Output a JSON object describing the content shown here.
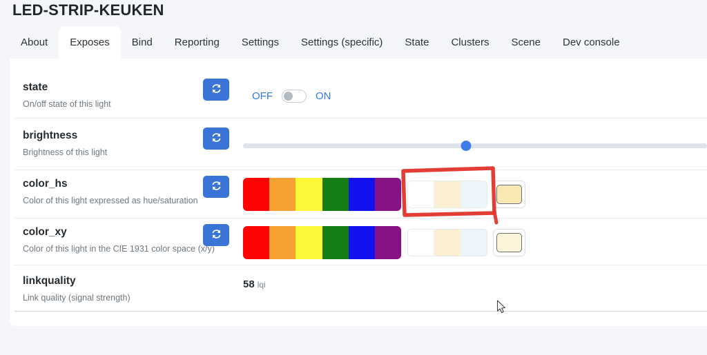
{
  "page": {
    "title": "LED-STRIP-KEUKEN"
  },
  "tabs": {
    "items": [
      {
        "label": "About",
        "active": false
      },
      {
        "label": "Exposes",
        "active": true
      },
      {
        "label": "Bind",
        "active": false
      },
      {
        "label": "Reporting",
        "active": false
      },
      {
        "label": "Settings",
        "active": false
      },
      {
        "label": "Settings (specific)",
        "active": false
      },
      {
        "label": "State",
        "active": false
      },
      {
        "label": "Clusters",
        "active": false
      },
      {
        "label": "Scene",
        "active": false
      },
      {
        "label": "Dev console",
        "active": false
      }
    ]
  },
  "exposes": {
    "rows": [
      {
        "name": "state",
        "description": "On/off state of this light",
        "toggle": {
          "off_label": "OFF",
          "on_label": "ON",
          "state": "off"
        }
      },
      {
        "name": "brightness",
        "description": "Brightness of this light",
        "slider": {
          "percent": 48
        }
      },
      {
        "name": "color_hs",
        "description": "Color of this light expressed as hue/saturation",
        "color_presets": [
          "#ff0202",
          "#f8a133",
          "#fdf73a",
          "#147d14",
          "#1311ee",
          "#861386"
        ],
        "white_presets": [
          "#ffffff",
          "#fcf0d2",
          "#edf7fb"
        ],
        "picker_color": "#f8e8b4",
        "annotated": true
      },
      {
        "name": "color_xy",
        "description": "Color of this light in the CIE 1931 color space (x/y)",
        "color_presets": [
          "#ff0202",
          "#f8a133",
          "#fdf73a",
          "#147d14",
          "#1311ee",
          "#861386"
        ],
        "white_presets": [
          "#ffffff",
          "#fcf0d2",
          "#edf7fb"
        ],
        "picker_color": "#fcf5da",
        "annotated": false
      },
      {
        "name": "linkquality",
        "description": "Link quality (signal strength)",
        "value": "58",
        "unit": "lqi"
      }
    ]
  },
  "colors": {
    "refresh_button": "#3a74d6",
    "link_blue": "#2e78ea",
    "slider_thumb": "#3f7ce8",
    "slider_track": "#dfe4ea",
    "annotation_red": "#e2342a",
    "page_bg": "#f4f6f9"
  }
}
